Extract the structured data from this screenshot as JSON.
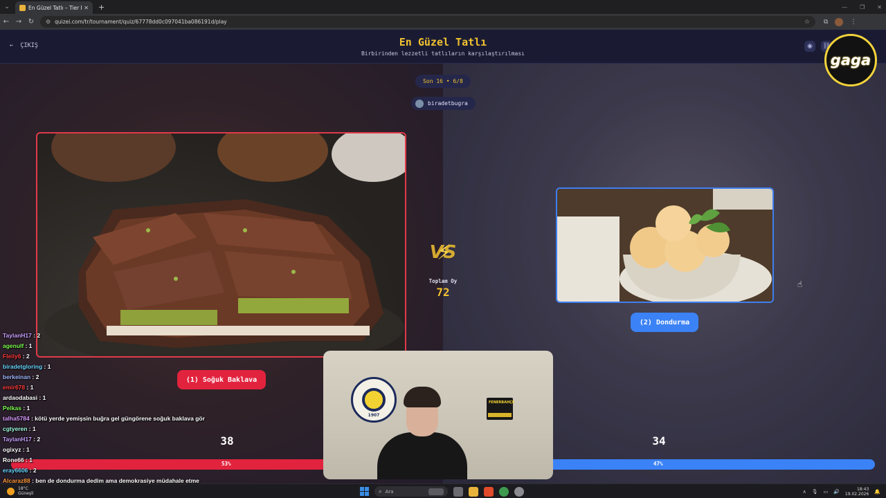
{
  "browser": {
    "tab_title": "En Güzel Tatlı – Tier List, Kör Seç",
    "url": "quizei.com/tr/tournament/quiz/67778dd0c097041ba086191d/play"
  },
  "header": {
    "exit_label": "ÇIKIŞ",
    "title": "En Güzel Tatlı",
    "subtitle": "Birbirinden lezzetli tatlıların karşılaştırılması"
  },
  "round": {
    "label": "Son 16 • 6/8",
    "user": "biradetbugra"
  },
  "matchup": {
    "total_label": "Toplam Oy",
    "total_value": "72",
    "left": {
      "label": "(1) Soğuk Baklava",
      "votes": "38",
      "percent_text": "53%",
      "percent": 53,
      "color": "#e2233e"
    },
    "right": {
      "label": "(2) Dondurma",
      "votes": "34",
      "percent_text": "47%",
      "percent": 47,
      "color": "#3b82f6"
    }
  },
  "overlay": {
    "brand": "gaga",
    "chat": [
      {
        "user": "TaylanH17",
        "msg": " : 2",
        "color": "#c9a0ff"
      },
      {
        "user": "agenulf",
        "msg": " : 1",
        "color": "#7cff4f"
      },
      {
        "user": "Fleily6",
        "msg": " : 2",
        "color": "#ff3c3c"
      },
      {
        "user": "biradetgloring",
        "msg": " : 1",
        "color": "#6ad6ff"
      },
      {
        "user": "berkeinan",
        "msg": " : 2",
        "color": "#a0b8ff"
      },
      {
        "user": "emir678",
        "msg": " : 1",
        "color": "#ff3c3c"
      },
      {
        "user": "ardaodabasi",
        "msg": " : 1",
        "color": "#ffffff"
      },
      {
        "user": "Pelkas",
        "msg": " : 1",
        "color": "#7cff4f"
      },
      {
        "user": "talha5784",
        "msg": " : kötü yerde yemişsin buğra gel güngörene soğuk baklava gör",
        "color": "#d79cff"
      },
      {
        "user": "cgtyeren",
        "msg": " : 1",
        "color": "#a0ffe0"
      },
      {
        "user": "TaylanH17",
        "msg": " : 2",
        "color": "#c9a0ff"
      },
      {
        "user": "ogixyz",
        "msg": " : 1",
        "color": "#ffffff"
      },
      {
        "user": "Rone66",
        "msg": " : 1",
        "color": "#ffffff"
      },
      {
        "user": "eray6606",
        "msg": " : 2",
        "color": "#6ad6ff"
      },
      {
        "user": "Alcaraz88",
        "msg": " : ben de dondurma dedim ama demokrasiye müdahale etme",
        "color": "#ff9b3c"
      }
    ],
    "webcam": {
      "emblem_year": "1907",
      "sign_text": "FENERBAHÇE"
    }
  },
  "taskbar": {
    "weather_temp": "18°C",
    "weather_desc": "Güneşli",
    "search_placeholder": "Ara",
    "time": "18:43",
    "date": "19.02.2026"
  }
}
